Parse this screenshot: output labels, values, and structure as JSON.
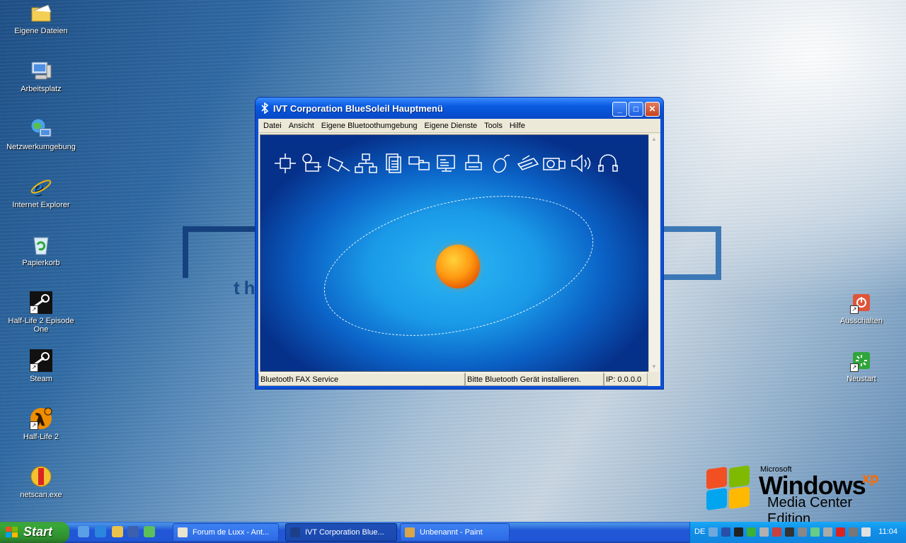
{
  "desktop": {
    "icons": [
      {
        "label": "Eigene Dateien"
      },
      {
        "label": "Arbeitsplatz"
      },
      {
        "label": "Netzwerkumgebung"
      },
      {
        "label": "Internet Explorer"
      },
      {
        "label": "Papierkorb"
      },
      {
        "label": "Half-Life 2 Episode One"
      },
      {
        "label": "Steam"
      },
      {
        "label": "Half-Life 2"
      },
      {
        "label": "netscan.exe"
      }
    ],
    "right_icons": [
      {
        "label": "Ausschalten"
      },
      {
        "label": "Neustart"
      }
    ],
    "wallpaper_text": "th"
  },
  "window": {
    "title": "IVT Corporation BlueSoleil Hauptmenü",
    "minimize": "_",
    "maximize": "□",
    "close": "✕",
    "menu": [
      "Datei",
      "Ansicht",
      "Eigene Bluetoothumgebung",
      "Eigene Dienste",
      "Tools",
      "Hilfe"
    ],
    "status": {
      "service": "Bluetooth FAX Service",
      "message": "Bitte Bluetooth Gerät installieren.",
      "ip": "IP: 0.0.0.0"
    },
    "service_icons": [
      "network-access-icon",
      "dialup-icon",
      "serial-port-icon",
      "lan-access-icon",
      "file-transfer-icon",
      "pim-sync-icon",
      "object-push-icon",
      "printer-icon",
      "hid-icon",
      "fax-icon",
      "camera-icon",
      "audio-gateway-icon",
      "headset-icon"
    ]
  },
  "branding": {
    "microsoft": "Microsoft",
    "windows": "Windows",
    "xp": "xp",
    "edition": "Media Center Edition"
  },
  "taskbar": {
    "start": "Start",
    "tasks": [
      {
        "label": "Forum de Luxx - Ant..."
      },
      {
        "label": "IVT Corporation Blue..."
      },
      {
        "label": "Unbenannt - Paint"
      }
    ],
    "lang": "DE",
    "clock": "11:04"
  }
}
